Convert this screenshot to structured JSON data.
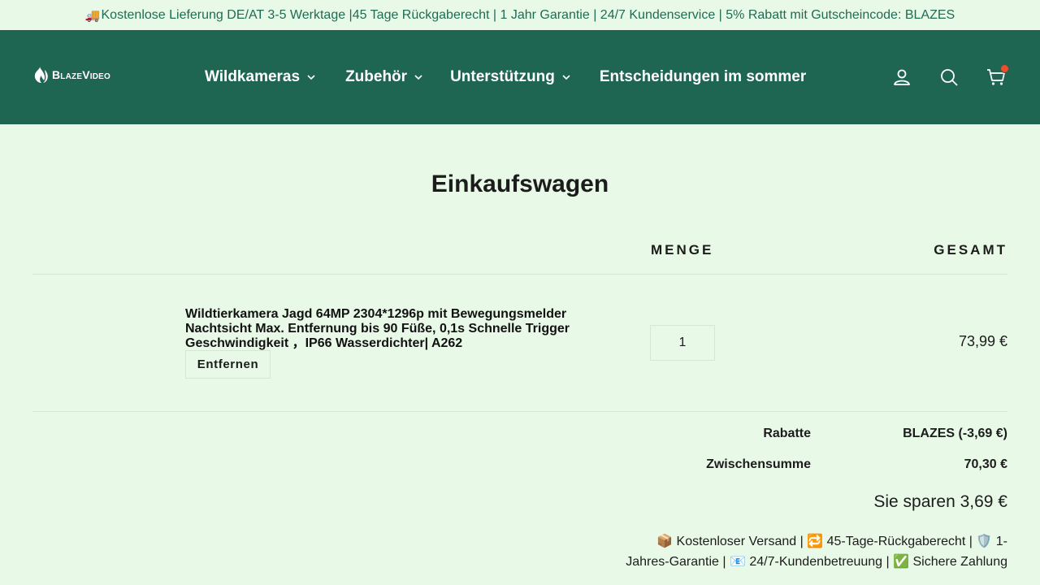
{
  "announcement": {
    "icon": "truck-icon",
    "text": "Kostenlose Lieferung DE/AT 3-5 Werktage |45 Tage Rückgaberecht | 1 Jahr Garantie | 24/7 Kundenservice | 5% Rabatt mit Gutscheincode: BLAZES"
  },
  "header": {
    "logo_text": "BlazeVideo",
    "nav": [
      {
        "label": "Wildkameras",
        "has_dropdown": true
      },
      {
        "label": "Zubehör",
        "has_dropdown": true
      },
      {
        "label": "Unterstützung",
        "has_dropdown": true
      },
      {
        "label": "Entscheidungen im sommer",
        "has_dropdown": false
      }
    ],
    "icons": [
      "account-icon",
      "search-icon",
      "cart-icon"
    ]
  },
  "cart": {
    "title": "Einkaufswagen",
    "columns": {
      "quantity": "MENGE",
      "total": "GESAMT"
    },
    "item": {
      "title": "Wildtierkamera Jagd 64MP 2304*1296p mit Bewegungsmelder Nachtsicht Max. Entfernung bis 90 Füße, 0,1s Schnelle Trigger Geschwindigkeit ，IP66 Wasserdichter| A262",
      "remove_label": "Entfernen",
      "quantity": "1",
      "price": "73,99 €"
    },
    "summary": {
      "discount_label": "Rabatte",
      "discount_value": "BLAZES (-3,69 €)",
      "subtotal_label": "Zwischensumme",
      "subtotal_value": "70,30 €",
      "savings": "Sie sparen 3,69 €"
    },
    "trust_text": "📦 Kostenloser Versand | 🔁 45-Tage-Rückgaberecht | 🛡️ 1-Jahres-Garantie | 📧 24/7-Kundenbetreuung | ✅ Sichere Zahlung"
  },
  "colors": {
    "background": "#e9f9e8",
    "header": "#1f6652",
    "announcement_text": "#1f6b54",
    "cart_badge": "#f24b2b"
  }
}
